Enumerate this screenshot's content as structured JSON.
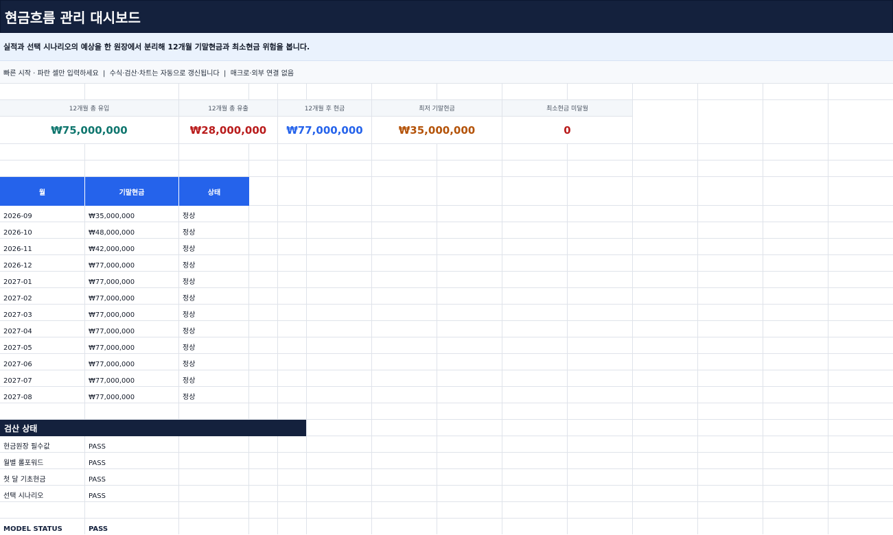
{
  "title": "현금흐름 관리 대시보드",
  "subtitle": "실적과 선택 시나리오의 예상을 한 원장에서 분리해 12개월 기말현금과 최소현금 위험을 봅니다.",
  "quick_start": "빠른 시작 · 파란 셀만 입력하세요  |  수식·검산·차트는 자동으로 갱신됩니다  |  매크로·외부 연결 없음",
  "kpis": [
    {
      "label": "12개월 총 유입",
      "value": "₩75,000,000",
      "color": "#0f766e"
    },
    {
      "label": "12개월 총 유출",
      "value": "₩28,000,000",
      "color": "#b91c1c"
    },
    {
      "label": "12개월 후 현금",
      "value": "₩77,000,000",
      "color": "#2563eb"
    },
    {
      "label": "최저 기말현금",
      "value": "₩35,000,000",
      "color": "#b45309"
    },
    {
      "label": "최소현금 미달월",
      "value": "0",
      "color": "#b91c1c"
    }
  ],
  "table": {
    "headers": [
      "월",
      "기말현금",
      "상태"
    ],
    "rows": [
      [
        "2026-09",
        "₩35,000,000",
        "정상"
      ],
      [
        "2026-10",
        "₩48,000,000",
        "정상"
      ],
      [
        "2026-11",
        "₩42,000,000",
        "정상"
      ],
      [
        "2026-12",
        "₩77,000,000",
        "정상"
      ],
      [
        "2027-01",
        "₩77,000,000",
        "정상"
      ],
      [
        "2027-02",
        "₩77,000,000",
        "정상"
      ],
      [
        "2027-03",
        "₩77,000,000",
        "정상"
      ],
      [
        "2027-04",
        "₩77,000,000",
        "정상"
      ],
      [
        "2027-05",
        "₩77,000,000",
        "정상"
      ],
      [
        "2027-06",
        "₩77,000,000",
        "정상"
      ],
      [
        "2027-07",
        "₩77,000,000",
        "정상"
      ],
      [
        "2027-08",
        "₩77,000,000",
        "정상"
      ]
    ]
  },
  "checks": {
    "title": "검산 상태",
    "items": [
      {
        "label": "현금원장 필수값",
        "status": "PASS"
      },
      {
        "label": "월별 롤포워드",
        "status": "PASS"
      },
      {
        "label": "첫 달 기초현금",
        "status": "PASS"
      },
      {
        "label": "선택 시나리오",
        "status": "PASS"
      }
    ],
    "model_status_label": "MODEL STATUS",
    "model_status_value": "PASS"
  }
}
